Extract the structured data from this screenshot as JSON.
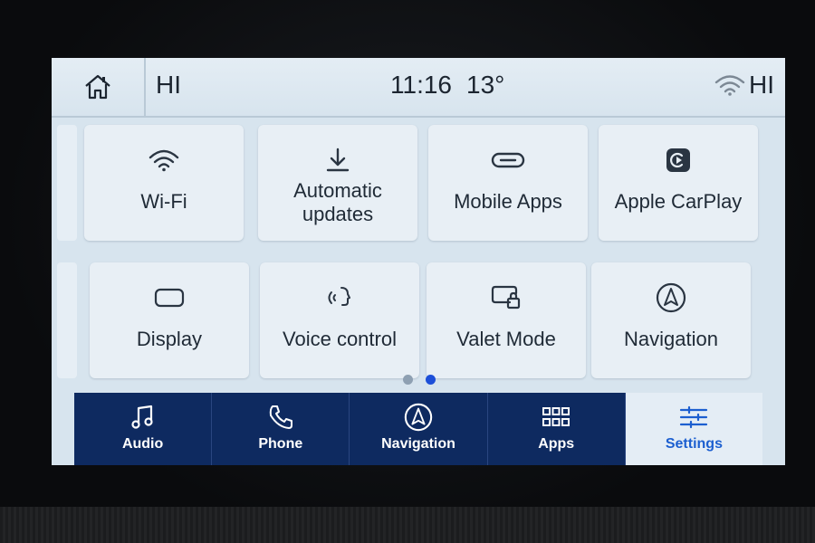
{
  "status_bar": {
    "left_label": "HI",
    "time": "11:16",
    "temperature": "13°",
    "right_label": "HI"
  },
  "tiles": [
    {
      "label": "Wi-Fi",
      "icon": "wifi-icon"
    },
    {
      "label": "Automatic\nupdates",
      "icon": "download-icon"
    },
    {
      "label": "Mobile Apps",
      "icon": "link-icon"
    },
    {
      "label": "Apple CarPlay",
      "icon": "carplay-icon"
    },
    {
      "label": "Display",
      "icon": "display-icon"
    },
    {
      "label": "Voice control",
      "icon": "voice-icon"
    },
    {
      "label": "Valet Mode",
      "icon": "valet-lock-icon"
    },
    {
      "label": "Navigation",
      "icon": "navigation-icon"
    }
  ],
  "pagination": {
    "pages": 2,
    "current": 2
  },
  "nav": [
    {
      "label": "Audio",
      "icon": "music-note-icon"
    },
    {
      "label": "Phone",
      "icon": "phone-icon"
    },
    {
      "label": "Navigation",
      "icon": "navigation-icon"
    },
    {
      "label": "Apps",
      "icon": "apps-grid-icon"
    },
    {
      "label": "Settings",
      "icon": "sliders-icon",
      "selected": true
    }
  ],
  "colors": {
    "nav_background": "#0e2a60",
    "accent": "#1c5fd0",
    "screen_background": "#d7e4ee"
  }
}
